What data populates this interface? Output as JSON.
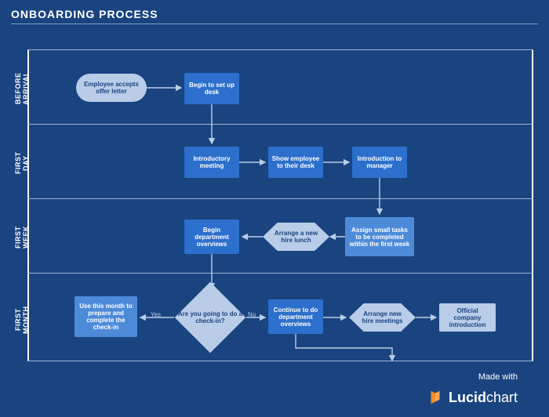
{
  "title": "ONBOARDING PROCESS",
  "lanes": {
    "before": "BEFORE ARRIVAL",
    "day": "FIRST DAY",
    "week": "FIRST WEEK",
    "month": "FIRST MONTH"
  },
  "nodes": {
    "accept_offer": "Employee accepts offer letter",
    "setup_desk": "Begin to set up desk",
    "intro_meeting": "Introductory meeting",
    "show_desk": "Show employee to their desk",
    "intro_manager": "Introduction to manager",
    "assign_tasks": "Assign small tasks to be completed within the first week",
    "hire_lunch": "Arrange a new hire lunch",
    "dept_overviews": "Begin department overviews",
    "checkin_q": "Are you going to do a check-in?",
    "prepare_checkin": "Use this month to prepare and complete the check-in",
    "continue_dept": "Continue to do department overviews",
    "hire_meetings": "Arrange new hire meetings",
    "company_intro": "Official company introduction"
  },
  "edges": {
    "yes": "Yes",
    "no": "No"
  },
  "footer": {
    "made_with": "Made with",
    "brand_a": "Lucid",
    "brand_b": "chart"
  }
}
